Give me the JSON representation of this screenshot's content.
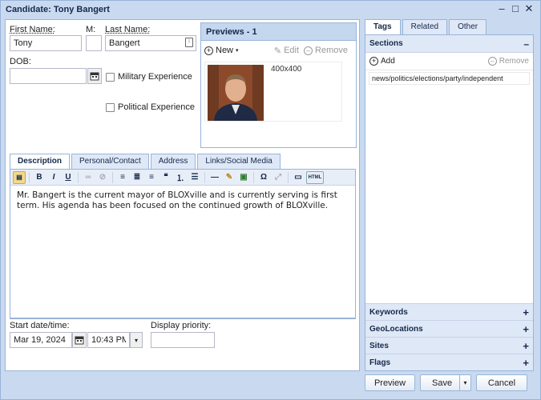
{
  "window": {
    "title": "Candidate: Tony Bangert"
  },
  "form": {
    "first_name_label": "First Name:",
    "first_name_value": "Tony",
    "middle_label": "M:",
    "middle_value": "",
    "last_name_label": "Last Name:",
    "last_name_value": "Bangert",
    "dob_label": "DOB:",
    "dob_value": "",
    "military_label": "Military Experience",
    "political_label": "Political Experience"
  },
  "previews": {
    "header": "Previews - 1",
    "new_label": "New",
    "edit_label": "Edit",
    "remove_label": "Remove",
    "item_size": "400x400"
  },
  "tabs": [
    "Description",
    "Personal/Contact",
    "Address",
    "Links/Social Media"
  ],
  "editor": {
    "text": "Mr. Bangert is the current mayor of BLOXville and is currently serving is first term. His agenda has been focused on the continued growth of BLOXville."
  },
  "schedule": {
    "start_label": "Start date/time:",
    "date_value": "Mar 19, 2024",
    "time_value": "10:43 PM",
    "priority_label": "Display priority:",
    "priority_value": ""
  },
  "right_tabs": [
    "Tags",
    "Related",
    "Other"
  ],
  "sections": {
    "header": "Sections",
    "add_label": "Add",
    "remove_label": "Remove",
    "items": [
      "news/politics/elections/party/independent"
    ]
  },
  "accordions": [
    "Keywords",
    "GeoLocations",
    "Sites",
    "Flags"
  ],
  "footer": {
    "preview_label": "Preview",
    "save_label": "Save",
    "cancel_label": "Cancel"
  },
  "colors": {
    "frame": "#c9daf0",
    "accent": "#99b4d9",
    "header_text": "#15284b"
  }
}
